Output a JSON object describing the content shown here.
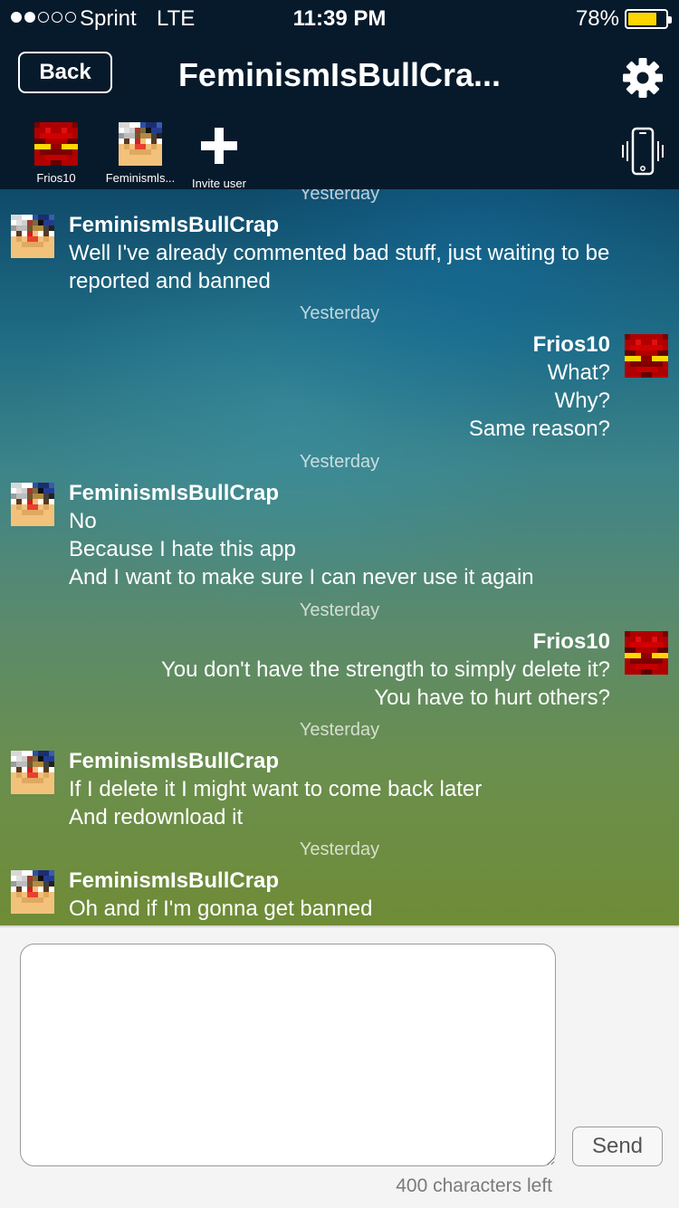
{
  "status_bar": {
    "carrier": "Sprint",
    "network": "LTE",
    "time": "11:39 PM",
    "battery_percent": "78%",
    "battery_level": 0.78,
    "signal_bars_filled": 2,
    "signal_bars_total": 5
  },
  "header": {
    "back_label": "Back",
    "title": "FeminismIsBullCra...",
    "settings_icon": "gear-icon",
    "vibrate_icon": "phone-vibrate-icon"
  },
  "participants": [
    {
      "name": "Frios10",
      "avatar": "red-pixel-avatar"
    },
    {
      "name": "Feminismls...",
      "avatar": "blocky-face-avatar"
    },
    {
      "name": "Invite user",
      "avatar": "plus-icon"
    }
  ],
  "messages": [
    {
      "timestamp": "Yesterday",
      "sender": "FeminismIsBullCrap",
      "side": "left",
      "lines": [
        "Well I've already commented bad stuff, just waiting to be",
        "reported and banned"
      ]
    },
    {
      "timestamp": "Yesterday",
      "sender": "Frios10",
      "side": "right",
      "lines": [
        "What?",
        "Why?",
        "Same reason?"
      ]
    },
    {
      "timestamp": "Yesterday",
      "sender": "FeminismIsBullCrap",
      "side": "left",
      "lines": [
        "No",
        "Because I hate this app",
        "And I want to make sure I can never use it again"
      ]
    },
    {
      "timestamp": "Yesterday",
      "sender": "Frios10",
      "side": "right",
      "lines": [
        "You don't have the strength to simply delete it?",
        "You have to hurt others?"
      ]
    },
    {
      "timestamp": "Yesterday",
      "sender": "FeminismIsBullCrap",
      "side": "left",
      "lines": [
        "If I delete it I might want to come back later",
        "And redownload it"
      ]
    },
    {
      "timestamp": "Yesterday",
      "sender": "FeminismIsBullCrap",
      "side": "left",
      "lines": [
        "Oh and if I'm gonna get banned"
      ]
    }
  ],
  "composer": {
    "value": "",
    "placeholder": "",
    "send_label": "Send",
    "chars_left": "400 characters left"
  },
  "colors": {
    "header_bg": "#071a2b",
    "battery": "#ffd500",
    "footer_bg": "#f4f4f4"
  }
}
